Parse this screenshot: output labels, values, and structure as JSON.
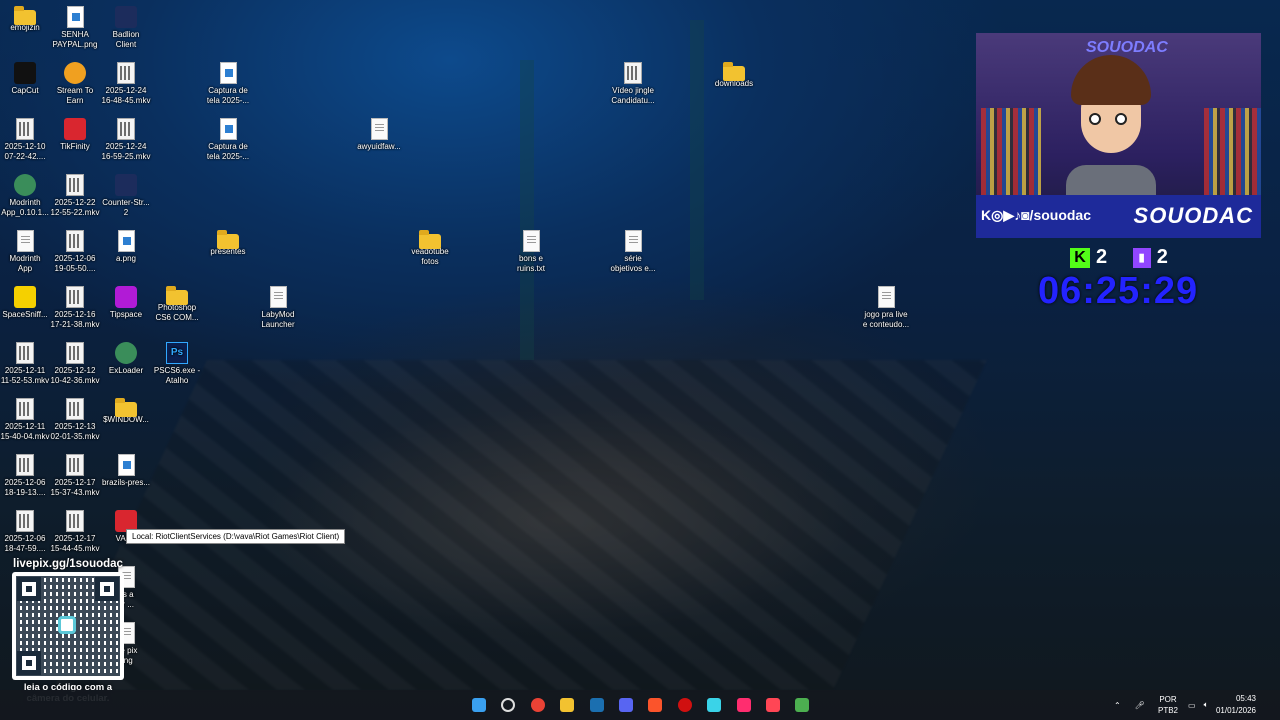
{
  "desktop_icons": [
    {
      "label": "emojizin",
      "type": "folder"
    },
    {
      "label": "SENHA\nPAYPAL.png",
      "type": "img"
    },
    {
      "label": "Badlion\nClient",
      "type": "app-blue"
    },
    {
      "label": "CapCut",
      "type": "app-dark"
    },
    {
      "label": "Stream To\nEarn",
      "type": "app-orange"
    },
    {
      "label": "2025-12-24\n16-48-45.mkv",
      "type": "video"
    },
    {
      "label": "Captura de\ntela 2025-...",
      "type": "img"
    },
    {
      "label": "Vídeo jingle\nCandidatu...",
      "type": "video"
    },
    {
      "label": "downloads",
      "type": "folder"
    },
    {
      "label": "2025-12-10\n07-22-42....",
      "type": "video"
    },
    {
      "label": "TikFinity",
      "type": "app-red"
    },
    {
      "label": "2025-12-24\n16-59-25.mkv",
      "type": "video"
    },
    {
      "label": "Captura de\ntela 2025-...",
      "type": "img"
    },
    {
      "label": "awyuidfaw...",
      "type": "doc"
    },
    {
      "label": "Modrinth\nApp_0.10.1...",
      "type": "app-green"
    },
    {
      "label": "2025-12-22\n12-55-22.mkv",
      "type": "video"
    },
    {
      "label": "Counter-Str...\n2",
      "type": "app-blue"
    },
    {
      "label": "Modrinth\nApp",
      "type": "doc"
    },
    {
      "label": "2025-12-06\n19-05-50....",
      "type": "video"
    },
    {
      "label": "a.png",
      "type": "img"
    },
    {
      "label": "presentes",
      "type": "folder"
    },
    {
      "label": "veadotube\nfotos",
      "type": "folder"
    },
    {
      "label": "bons e\nruins.txt",
      "type": "doc"
    },
    {
      "label": "série\nobjetivos e...",
      "type": "doc"
    },
    {
      "label": "SpaceSniff...",
      "type": "app-yellow"
    },
    {
      "label": "2025-12-16\n17-21-38.mkv",
      "type": "video"
    },
    {
      "label": "Tipspace",
      "type": "app-purple"
    },
    {
      "label": "Photoshop\nCS6 COM...",
      "type": "folder"
    },
    {
      "label": "LabyMod\nLauncher",
      "type": "doc"
    },
    {
      "label": "jogo pra live\ne conteudo...",
      "type": "doc"
    },
    {
      "label": "2025-12-11\n11-52-53.mkv",
      "type": "video"
    },
    {
      "label": "2025-12-12\n10-42-36.mkv",
      "type": "video"
    },
    {
      "label": "ExLoader",
      "type": "app-green"
    },
    {
      "label": "PSCS6.exe -\nAtalho",
      "type": "app-ps"
    },
    {
      "label": "2025-12-11\n15-40-04.mkv",
      "type": "video"
    },
    {
      "label": "2025-12-13\n02-01-35.mkv",
      "type": "video"
    },
    {
      "label": "$WINDOW...",
      "type": "folder"
    },
    {
      "label": "2025-12-06\n18-19-13....",
      "type": "video"
    },
    {
      "label": "2025-12-17\n15-37-43.mkv",
      "type": "video"
    },
    {
      "label": "brazils-pres...",
      "type": "img"
    },
    {
      "label": "2025-12-06\n18-47-59....",
      "type": "video"
    },
    {
      "label": "2025-12-17\n15-44-45.mkv",
      "type": "video"
    },
    {
      "label": "VALO",
      "type": "app-red"
    },
    {
      "label": "as a\nar ...",
      "type": "doc"
    },
    {
      "label": "ive pix\nong",
      "type": "doc"
    }
  ],
  "tooltip": {
    "text": "Local:   RiotClientServices (D:\\vava\\Riot Games\\Riot Client)"
  },
  "overlay": {
    "brand": "SOUODAC",
    "socials": "K◎▶♪◙/souodac",
    "kick_count": "2",
    "twitch_count": "2",
    "timer": "06:25:29",
    "qr_title": "livepix.gg/1souodac",
    "qr_caption": "leia o código com a\ncâmera do celular."
  },
  "taskbar": {
    "apps": [
      "windows-start",
      "search",
      "chrome",
      "file-explorer",
      "steam",
      "discord",
      "brave",
      "record",
      "notepad",
      "tiktok-live",
      "valorant",
      "minecraft"
    ],
    "lang_top": "POR",
    "lang_bottom": "PTB2",
    "time": "05:43",
    "date": "01/01/2026"
  },
  "colors": {
    "timer": "#2323ff",
    "banner": "#1e2a9a",
    "kick": "#53fc18",
    "twitch": "#9146ff"
  }
}
